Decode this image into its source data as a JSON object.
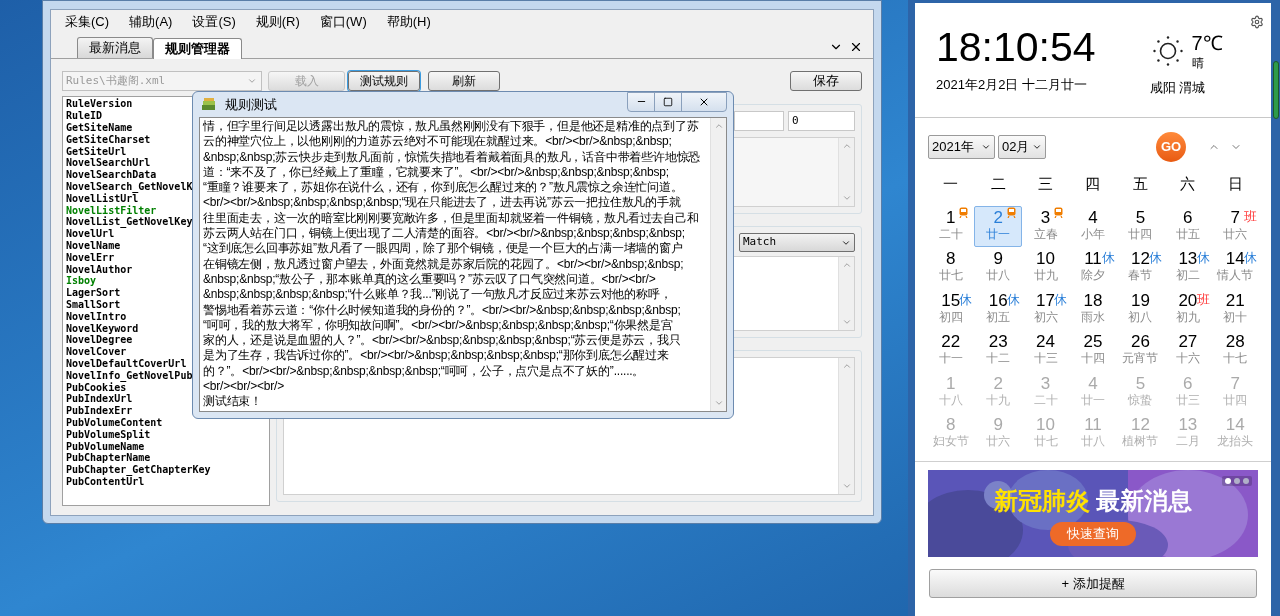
{
  "main_window": {
    "menu": [
      {
        "label": "采集(C)"
      },
      {
        "label": "辅助(A)"
      },
      {
        "label": "设置(S)"
      },
      {
        "label": "规则(R)"
      },
      {
        "label": "窗口(W)"
      },
      {
        "label": "帮助(H)"
      }
    ],
    "tabs": [
      {
        "label": "最新消息",
        "selected": false
      },
      {
        "label": "规则管理器",
        "selected": true
      }
    ],
    "rule_file": {
      "value": "Rules\\书趣阁.xml",
      "disabled": true
    },
    "buttons": [
      {
        "label": "载入",
        "disabled": true,
        "focused": false
      },
      {
        "label": "测试规则",
        "disabled": false,
        "focused": true
      },
      {
        "label": "刷新",
        "disabled": false,
        "focused": false
      }
    ],
    "save_button": "保存",
    "rules": [
      {
        "name": "RuleVersion",
        "color": "#000000"
      },
      {
        "name": "RuleID",
        "color": "#000000"
      },
      {
        "name": "GetSiteName",
        "color": "#000000"
      },
      {
        "name": "GetSiteCharset",
        "color": "#000000"
      },
      {
        "name": "GetSiteUrl",
        "color": "#000000"
      },
      {
        "name": "NovelSearchUrl",
        "color": "#000000"
      },
      {
        "name": "NovelSearchData",
        "color": "#000000"
      },
      {
        "name": "NovelSearch_GetNovelK",
        "color": "#000000"
      },
      {
        "name": "NovelListUrl",
        "color": "#000000"
      },
      {
        "name": "NovelListFilter",
        "color": "#008000"
      },
      {
        "name": "NovelList_GetNovelKey",
        "color": "#000000"
      },
      {
        "name": "NovelUrl",
        "color": "#000000"
      },
      {
        "name": "NovelName",
        "color": "#000000"
      },
      {
        "name": "NovelErr",
        "color": "#000000"
      },
      {
        "name": "NovelAuthor",
        "color": "#000000"
      },
      {
        "name": "Isboy",
        "color": "#008000"
      },
      {
        "name": "LagerSort",
        "color": "#000000"
      },
      {
        "name": "SmallSort",
        "color": "#000000"
      },
      {
        "name": "NovelIntro",
        "color": "#000000"
      },
      {
        "name": "NovelKeyword",
        "color": "#000000"
      },
      {
        "name": "NovelDegree",
        "color": "#000000"
      },
      {
        "name": "NovelCover",
        "color": "#000000"
      },
      {
        "name": "NovelDefaultCoverUrl",
        "color": "#000000"
      },
      {
        "name": "NovelInfo_GetNovelPub",
        "color": "#000000"
      },
      {
        "name": "PubCookies",
        "color": "#000000"
      },
      {
        "name": "PubIndexUrl",
        "color": "#000000"
      },
      {
        "name": "PubIndexErr",
        "color": "#000000"
      },
      {
        "name": "PubVolumeContent",
        "color": "#000000"
      },
      {
        "name": "PubVolumeSplit",
        "color": "#000000"
      },
      {
        "name": "PubVolumeName",
        "color": "#000000"
      },
      {
        "name": "PubChapterName",
        "color": "#000000"
      },
      {
        "name": "PubChapter_GetChapterKey",
        "color": "#000000"
      },
      {
        "name": "PubContentUrl",
        "color": "#000000"
      }
    ],
    "number_field": {
      "value": "0"
    },
    "match_select": {
      "value": "Match"
    }
  },
  "dialog": {
    "title": "规则测试",
    "lines": [
      "情，但字里行间足以透露出敖凡的震惊，敖凡虽然刚刚没有下狠手，但是他还是精准的点到了苏",
      "云的神堂穴位上，以他刚刚的力道苏云绝对不可能现在就醒过来。<br/><br/>&nbsp;&nbsp;",
      "&nbsp;&nbsp;苏云快步走到敖凡面前，惊慌失措地看着戴着面具的敖凡，话音中带着些许地惊恐",
      "道：“来不及了，你已经戴上了重瞳，它就要来了”。<br/><br/>&nbsp;&nbsp;&nbsp;&nbsp;",
      "“重瞳？谁要来了，苏姐你在说什么，还有，你到底怎么醒过来的？”敖凡震惊之余连忙问道。",
      "<br/><br/>&nbsp;&nbsp;&nbsp;&nbsp;“现在只能进去了，进去再说”苏云一把拉住敖凡的手就",
      "往里面走去，这一次的暗室比刚刚要宽敞许多，但是里面却就竖着一件铜镜，敖凡看过去自己和",
      "苏云两人站在门口，铜镜上便出现了二人清楚的面容。<br/><br/>&nbsp;&nbsp;&nbsp;&nbsp;",
      "“这到底怎么回事苏姐”敖凡看了一眼四周，除了那个铜镜，便是一个巨大的占满一堵墙的窗户",
      "在铜镜左侧，敖凡透过窗户望去，外面竟然就是苏家后院的花园了。<br/><br/>&nbsp;&nbsp;",
      "&nbsp;&nbsp;“敖公子，那本账单真的这么重要吗？”苏云叹了口气突然问道。<br/><br/>",
      "&nbsp;&nbsp;&nbsp;&nbsp;“什么账单？我...”刚说了一句敖凡才反应过来苏云对他的称呼，",
      "警惕地看着苏云道：“你什么时候知道我的身份的？”。<br/><br/>&nbsp;&nbsp;&nbsp;&nbsp;",
      "“呵呵，我的敖大将军，你明知故问啊”。<br/><br/>&nbsp;&nbsp;&nbsp;&nbsp;“你果然是宫",
      "家的人，还是说是血盟的人？”。<br/><br/>&nbsp;&nbsp;&nbsp;&nbsp;“苏云便是苏云，我只",
      "是为了生存，我告诉过你的”。<br/><br/>&nbsp;&nbsp;&nbsp;&nbsp;“那你到底怎么醒过来",
      "的？”。<br/><br/>&nbsp;&nbsp;&nbsp;&nbsp;“呵呵，公子，点穴是点不了妖的”......。",
      "<br/><br/><br/>",
      "测试结束！"
    ]
  },
  "calendar": {
    "time": "18:10:54",
    "date": "2021年2月2日 十二月廿一",
    "weather": {
      "temperature": "7℃",
      "condition": "晴",
      "location": "咸阳 渭城"
    },
    "year": "2021年",
    "month": "02月",
    "logo": "GO",
    "weekdays": [
      "一",
      "二",
      "三",
      "四",
      "五",
      "六",
      "日"
    ],
    "days": [
      {
        "day": "1",
        "lunar": "二十",
        "in_month": true,
        "selected": false,
        "badge": {
          "kind": "train"
        }
      },
      {
        "day": "2",
        "lunar": "廿一",
        "in_month": true,
        "selected": true,
        "badge": {
          "kind": "train"
        }
      },
      {
        "day": "3",
        "lunar": "立春",
        "in_month": true,
        "selected": false,
        "badge": {
          "kind": "train"
        }
      },
      {
        "day": "4",
        "lunar": "小年",
        "in_month": true,
        "selected": false
      },
      {
        "day": "5",
        "lunar": "廿四",
        "in_month": true,
        "selected": false
      },
      {
        "day": "6",
        "lunar": "廿五",
        "in_month": true,
        "selected": false
      },
      {
        "day": "7",
        "lunar": "廿六",
        "in_month": true,
        "selected": false,
        "badge": {
          "kind": "work",
          "text": "班"
        }
      },
      {
        "day": "8",
        "lunar": "廿七",
        "in_month": true,
        "selected": false
      },
      {
        "day": "9",
        "lunar": "廿八",
        "in_month": true,
        "selected": false
      },
      {
        "day": "10",
        "lunar": "廿九",
        "in_month": true,
        "selected": false
      },
      {
        "day": "11",
        "lunar": "除夕",
        "in_month": true,
        "selected": false,
        "badge": {
          "kind": "rest",
          "text": "休"
        }
      },
      {
        "day": "12",
        "lunar": "春节",
        "in_month": true,
        "selected": false,
        "badge": {
          "kind": "rest",
          "text": "休"
        }
      },
      {
        "day": "13",
        "lunar": "初二",
        "in_month": true,
        "selected": false,
        "badge": {
          "kind": "rest",
          "text": "休"
        }
      },
      {
        "day": "14",
        "lunar": "情人节",
        "in_month": true,
        "selected": false,
        "badge": {
          "kind": "rest",
          "text": "休"
        }
      },
      {
        "day": "15",
        "lunar": "初四",
        "in_month": true,
        "selected": false,
        "badge": {
          "kind": "rest",
          "text": "休"
        }
      },
      {
        "day": "16",
        "lunar": "初五",
        "in_month": true,
        "selected": false,
        "badge": {
          "kind": "rest",
          "text": "休"
        }
      },
      {
        "day": "17",
        "lunar": "初六",
        "in_month": true,
        "selected": false,
        "badge": {
          "kind": "rest",
          "text": "休"
        }
      },
      {
        "day": "18",
        "lunar": "雨水",
        "in_month": true,
        "selected": false
      },
      {
        "day": "19",
        "lunar": "初八",
        "in_month": true,
        "selected": false
      },
      {
        "day": "20",
        "lunar": "初九",
        "in_month": true,
        "selected": false,
        "badge": {
          "kind": "work",
          "text": "班"
        }
      },
      {
        "day": "21",
        "lunar": "初十",
        "in_month": true,
        "selected": false
      },
      {
        "day": "22",
        "lunar": "十一",
        "in_month": true,
        "selected": false
      },
      {
        "day": "23",
        "lunar": "十二",
        "in_month": true,
        "selected": false
      },
      {
        "day": "24",
        "lunar": "十三",
        "in_month": true,
        "selected": false
      },
      {
        "day": "25",
        "lunar": "十四",
        "in_month": true,
        "selected": false
      },
      {
        "day": "26",
        "lunar": "元宵节",
        "in_month": true,
        "selected": false
      },
      {
        "day": "27",
        "lunar": "十六",
        "in_month": true,
        "selected": false
      },
      {
        "day": "28",
        "lunar": "十七",
        "in_month": true,
        "selected": false
      },
      {
        "day": "1",
        "lunar": "十八",
        "in_month": false,
        "selected": false
      },
      {
        "day": "2",
        "lunar": "十九",
        "in_month": false,
        "selected": false
      },
      {
        "day": "3",
        "lunar": "二十",
        "in_month": false,
        "selected": false
      },
      {
        "day": "4",
        "lunar": "廿一",
        "in_month": false,
        "selected": false
      },
      {
        "day": "5",
        "lunar": "惊蛰",
        "in_month": false,
        "selected": false
      },
      {
        "day": "6",
        "lunar": "廿三",
        "in_month": false,
        "selected": false
      },
      {
        "day": "7",
        "lunar": "廿四",
        "in_month": false,
        "selected": false
      },
      {
        "day": "8",
        "lunar": "妇女节",
        "in_month": false,
        "selected": false
      },
      {
        "day": "9",
        "lunar": "廿六",
        "in_month": false,
        "selected": false
      },
      {
        "day": "10",
        "lunar": "廿七",
        "in_month": false,
        "selected": false
      },
      {
        "day": "11",
        "lunar": "廿八",
        "in_month": false,
        "selected": false
      },
      {
        "day": "12",
        "lunar": "植树节",
        "in_month": false,
        "selected": false
      },
      {
        "day": "13",
        "lunar": "二月",
        "in_month": false,
        "selected": false
      },
      {
        "day": "14",
        "lunar": "龙抬头",
        "in_month": false,
        "selected": false
      }
    ],
    "banner": {
      "headline_1": "新冠肺炎",
      "headline_2": "最新消息",
      "button": "快速查询",
      "slides": [
        {
          "selected": true
        },
        {
          "selected": false
        },
        {
          "selected": false
        }
      ]
    },
    "add_button": "+ 添加提醒"
  }
}
